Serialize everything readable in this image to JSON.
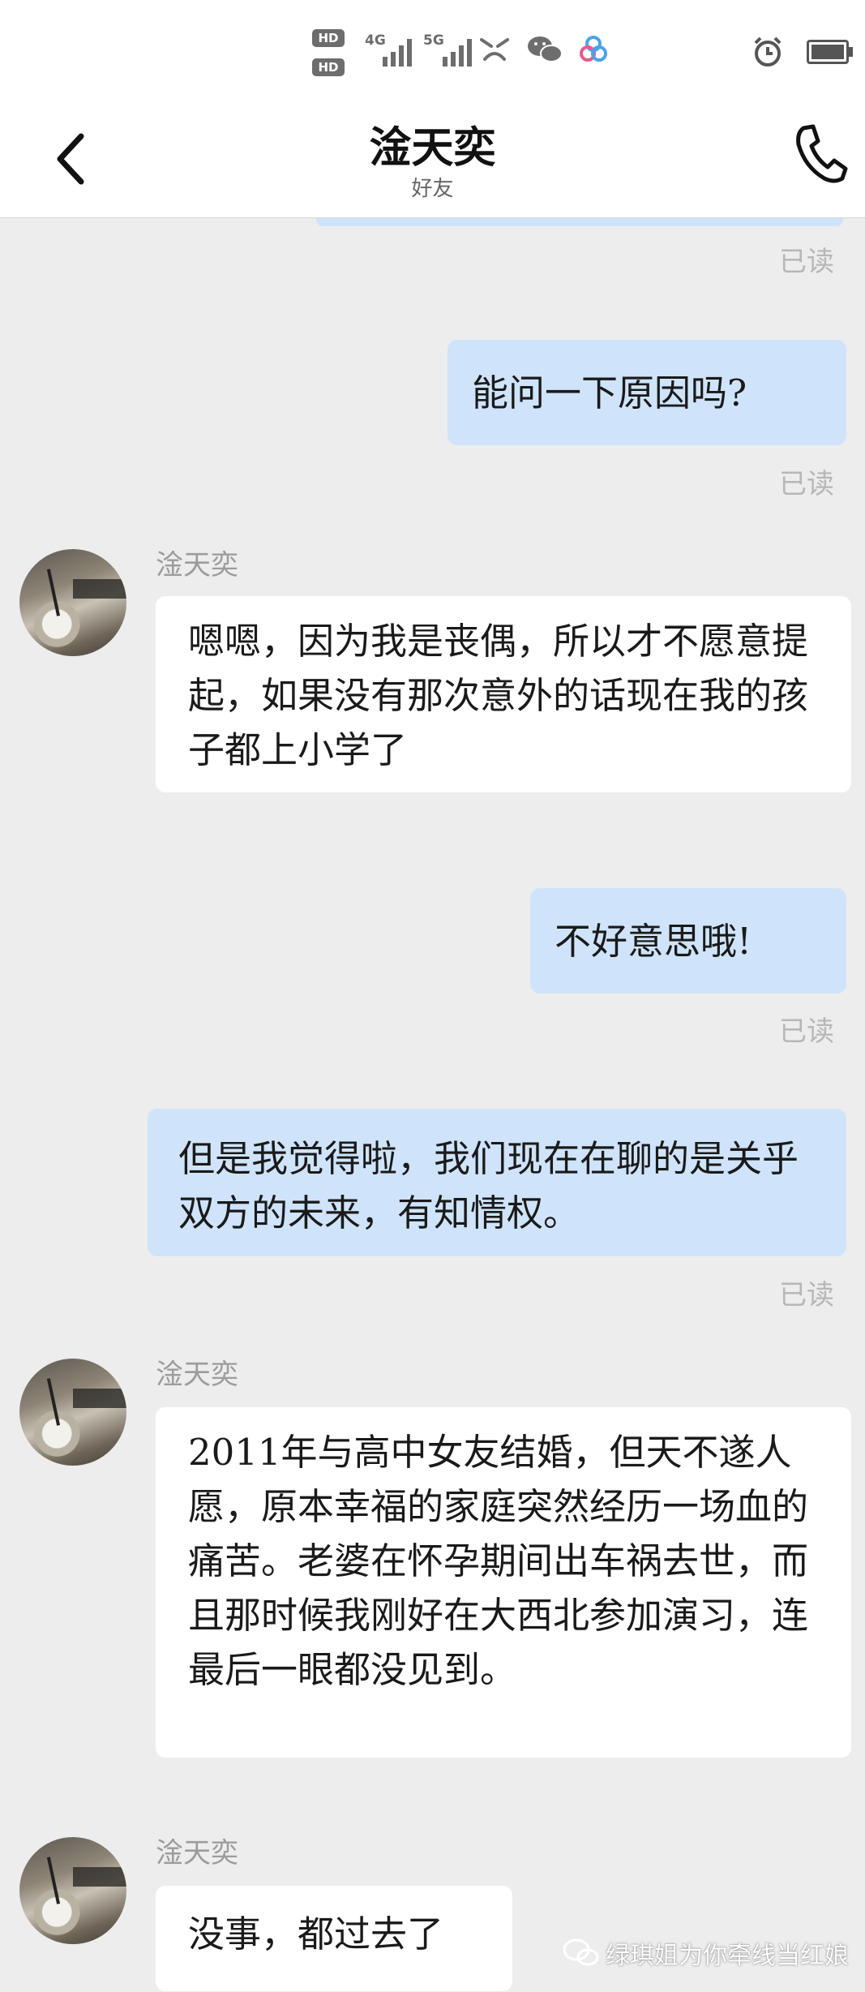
{
  "status_bar": {
    "hd1": "HD",
    "hd2": "HD",
    "net1": "4G",
    "net2": "5G",
    "icons": [
      "sad-face-icon",
      "wechat-icon",
      "app-icon"
    ],
    "right_icons": [
      "alarm-icon",
      "battery-icon"
    ]
  },
  "header": {
    "title": "淦天奕",
    "subtitle": "好友",
    "back_icon": "chevron-left-icon",
    "call_icon": "phone-icon"
  },
  "messages": [
    {
      "from": "me",
      "status": "已读"
    },
    {
      "from": "me",
      "text": "能问一下原因吗?",
      "status": "已读"
    },
    {
      "from": "them",
      "sender": "淦天奕",
      "text": "嗯嗯，因为我是丧偶，所以才不愿意提起，如果没有那次意外的话现在我的孩子都上小学了"
    },
    {
      "from": "me",
      "text": "不好意思哦!",
      "status": "已读"
    },
    {
      "from": "me",
      "text": "但是我觉得啦，我们现在在聊的是关乎双方的未来，有知情权。",
      "status": "已读"
    },
    {
      "from": "them",
      "sender": "淦天奕",
      "text": "2011年与高中女友结婚，但天不遂人愿，原本幸福的家庭突然经历一场血的痛苦。老婆在怀孕期间出车祸去世，而且那时候我刚好在大西北参加演习，连最后一眼都没见到。"
    },
    {
      "from": "them",
      "sender": "淦天奕",
      "text": "没事，都过去了"
    }
  ],
  "watermark": {
    "text": "绿琪姐为你牵线当红娘",
    "icon": "wechat-official-account-icon"
  },
  "colors": {
    "my_bubble": "#cfe4fa",
    "their_bubble": "#ffffff",
    "background": "#ededed",
    "read_receipt": "#b7b7b7"
  }
}
